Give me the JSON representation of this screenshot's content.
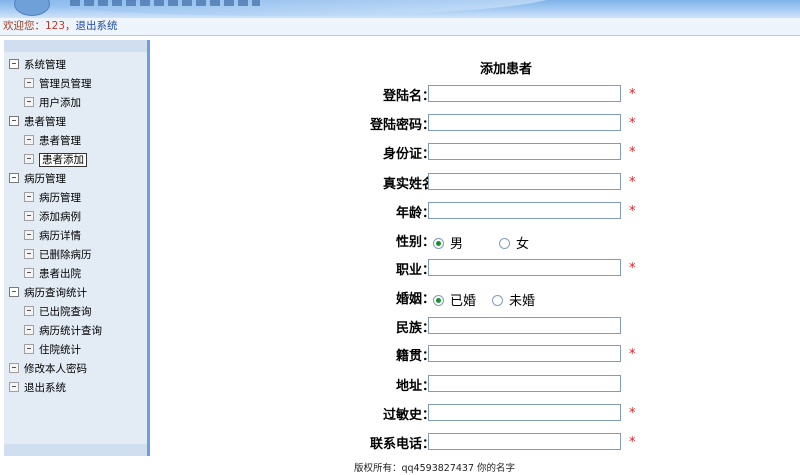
{
  "header": {
    "welcome_label": "欢迎您：",
    "username": "123",
    "separator": "，",
    "logout_link": "退出系统"
  },
  "sidebar": {
    "items": [
      {
        "label": "系统管理",
        "level": 0
      },
      {
        "label": "管理员管理",
        "level": 1
      },
      {
        "label": "用户添加",
        "level": 1
      },
      {
        "label": "患者管理",
        "level": 0
      },
      {
        "label": "患者管理",
        "level": 1
      },
      {
        "label": "患者添加",
        "level": 1,
        "selected": true
      },
      {
        "label": "病历管理",
        "level": 0
      },
      {
        "label": "病历管理",
        "level": 1
      },
      {
        "label": "添加病例",
        "level": 1
      },
      {
        "label": "病历详情",
        "level": 1
      },
      {
        "label": "已删除病历",
        "level": 1
      },
      {
        "label": "患者出院",
        "level": 1
      },
      {
        "label": "病历查询统计",
        "level": 0
      },
      {
        "label": "已出院查询",
        "level": 1
      },
      {
        "label": "病历统计查询",
        "level": 1
      },
      {
        "label": "住院统计",
        "level": 1
      },
      {
        "label": "修改本人密码",
        "level": 0
      },
      {
        "label": "退出系统",
        "level": 0
      }
    ]
  },
  "form": {
    "title": "添加患者",
    "required_mark": "*",
    "fields": {
      "login_name": {
        "label": "登陆名：",
        "value": ""
      },
      "password": {
        "label": "登陆密码：",
        "value": ""
      },
      "id_card": {
        "label": "身份证：",
        "value": ""
      },
      "real_name": {
        "label": "真实姓名",
        "value": ""
      },
      "age": {
        "label": "年龄：",
        "value": ""
      },
      "gender": {
        "label": "性别：",
        "options": [
          "男",
          "女"
        ],
        "selected": "男"
      },
      "occupation": {
        "label": "职业：",
        "value": ""
      },
      "marriage": {
        "label": "婚姻：",
        "options": [
          "已婚",
          "未婚"
        ],
        "selected": "已婚"
      },
      "ethnicity": {
        "label": "民族：",
        "value": ""
      },
      "hometown": {
        "label": "籍贯：",
        "value": ""
      },
      "address": {
        "label": "地址：",
        "value": ""
      },
      "allergy": {
        "label": "过敏史：",
        "value": ""
      },
      "phone": {
        "label": "联系电话：",
        "value": ""
      }
    }
  },
  "footer": {
    "copyright": "版权所有：qq4593827437 你的名字"
  },
  "colors": {
    "banner": "#7fb2ea",
    "sidebar_bg": "#e3ebf5",
    "sidebar_border": "#6d9fd8",
    "required": "#e02020",
    "radio_selected": "#1a8f2f"
  }
}
